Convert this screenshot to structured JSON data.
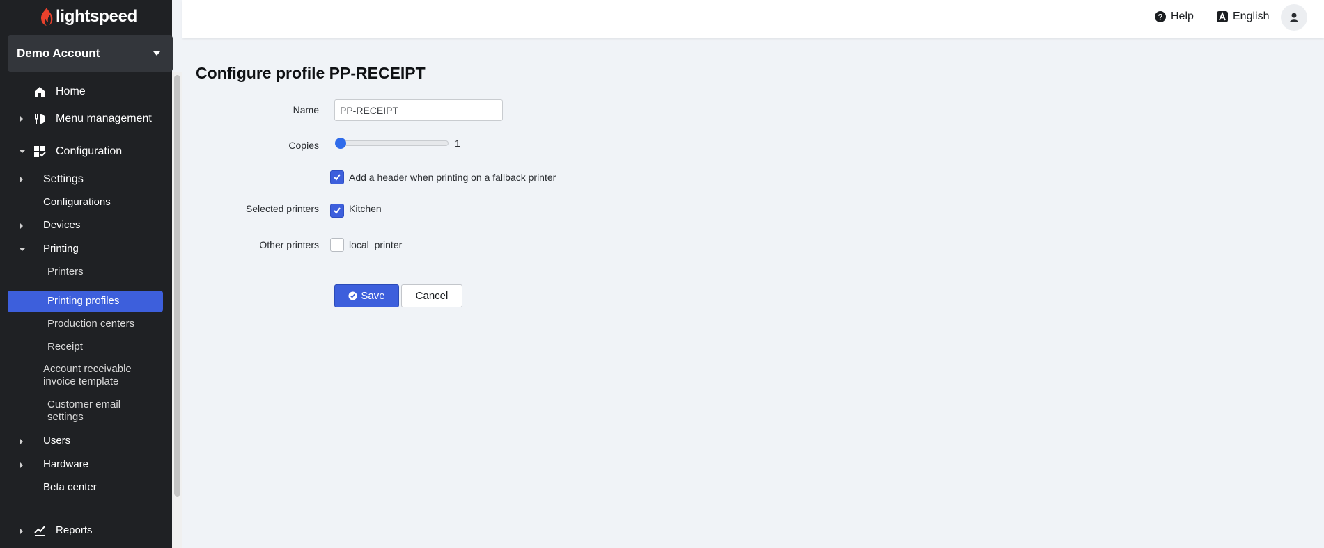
{
  "brand": {
    "name": "lightspeed",
    "color": "#e8412c"
  },
  "account": {
    "name": "Demo Account"
  },
  "sidebar": {
    "items": [
      {
        "label": "Home",
        "icon": "home-icon",
        "arrow": "none"
      },
      {
        "label": "Menu management",
        "icon": "menu-management-icon",
        "arrow": "right"
      },
      {
        "label": "Configuration",
        "icon": "configuration-icon",
        "arrow": "down"
      },
      {
        "label": "Settings",
        "arrow": "right"
      },
      {
        "label": "Configurations",
        "arrow": "none"
      },
      {
        "label": "Devices",
        "arrow": "right"
      },
      {
        "label": "Printing",
        "arrow": "down"
      },
      {
        "label": "Printers"
      },
      {
        "label": "Printing profiles",
        "active": true
      },
      {
        "label": "Production centers"
      },
      {
        "label": "Receipt"
      },
      {
        "label_line1": "Account receivable",
        "label_line2": "invoice template"
      },
      {
        "label_line1": "Customer email",
        "label_line2": "settings"
      },
      {
        "label": "Users",
        "arrow": "right"
      },
      {
        "label": "Hardware",
        "arrow": "right"
      },
      {
        "label": "Beta center",
        "arrow": "none"
      },
      {
        "label": "Reports",
        "icon": "reports-icon",
        "arrow": "right"
      }
    ]
  },
  "topbar": {
    "help_label": "Help",
    "language_label": "English"
  },
  "form": {
    "title": "Configure profile PP-RECEIPT",
    "name_label": "Name",
    "name_value": "PP-RECEIPT",
    "copies_label": "Copies",
    "copies_value": "1",
    "copies_level": 1,
    "header_option_label": "Add a header when printing on a fallback printer",
    "header_option_checked": true,
    "selected_printers_label": "Selected printers",
    "selected_printers": [
      {
        "name": "Kitchen",
        "checked": true
      }
    ],
    "other_printers_label": "Other printers",
    "other_printers": [
      {
        "name": "local_printer",
        "checked": false
      }
    ],
    "save_label": "Save",
    "cancel_label": "Cancel"
  },
  "colors": {
    "accent": "#3d5fdc",
    "sidebar_bg": "#1f2124",
    "page_bg": "#f0f3f7"
  }
}
